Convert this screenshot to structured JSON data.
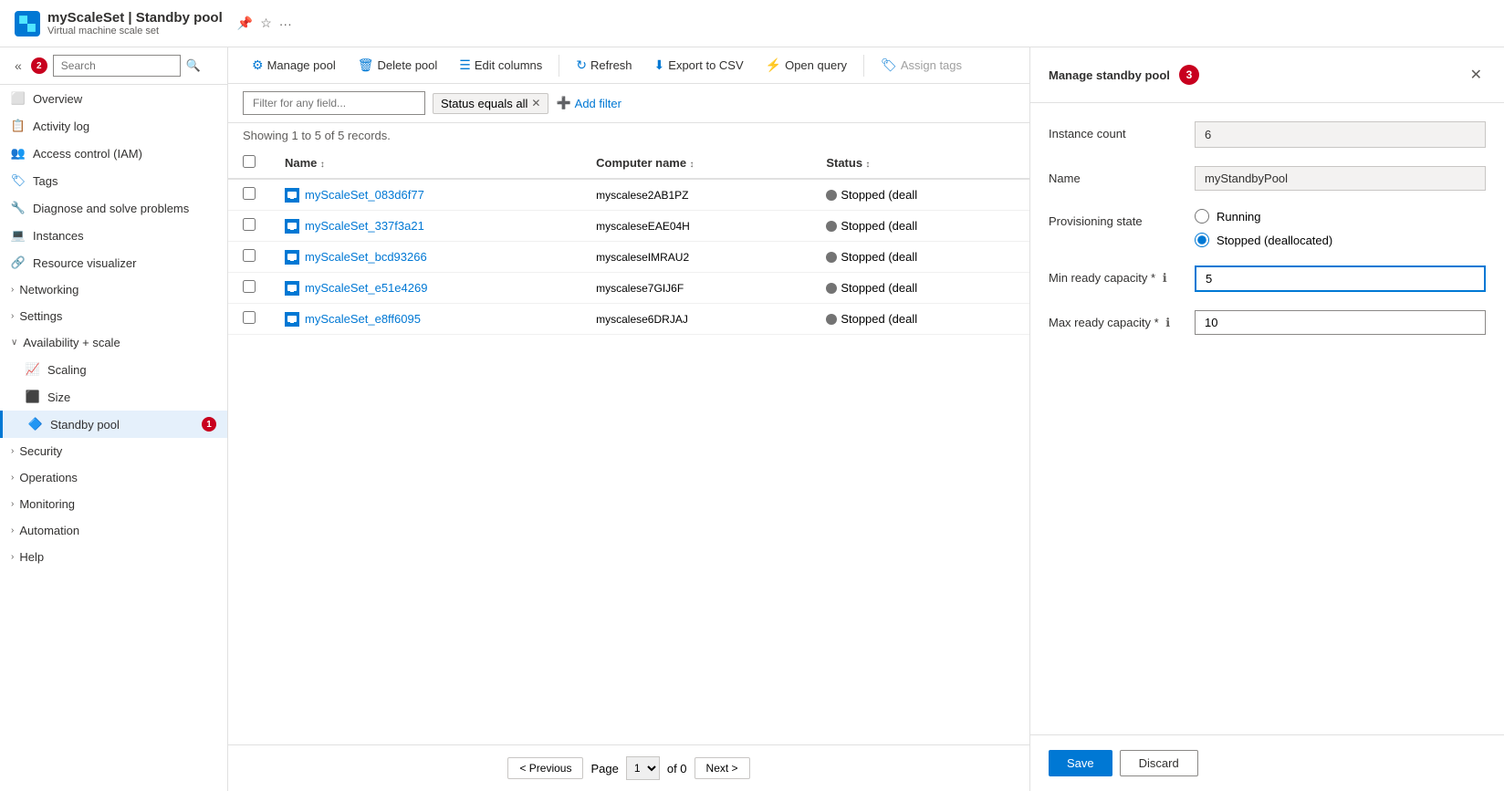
{
  "app": {
    "icon_label": "Azure",
    "title": "myScaleSet | Standby pool",
    "subtitle": "Virtual machine scale set",
    "pin_icon": "📌",
    "star_icon": "☆",
    "more_icon": "..."
  },
  "sidebar": {
    "search_placeholder": "Search",
    "collapse_icon": "«",
    "badge2": "2",
    "nav_items": [
      {
        "id": "overview",
        "label": "Overview",
        "icon": "overview"
      },
      {
        "id": "activity-log",
        "label": "Activity log",
        "icon": "log"
      },
      {
        "id": "access-control",
        "label": "Access control (IAM)",
        "icon": "iam"
      },
      {
        "id": "tags",
        "label": "Tags",
        "icon": "tags"
      },
      {
        "id": "diagnose",
        "label": "Diagnose and solve problems",
        "icon": "diagnose"
      },
      {
        "id": "instances",
        "label": "Instances",
        "icon": "instances"
      },
      {
        "id": "resource-visualizer",
        "label": "Resource visualizer",
        "icon": "visualizer"
      },
      {
        "id": "networking",
        "label": "Networking",
        "icon": "networking",
        "expandable": true
      },
      {
        "id": "settings",
        "label": "Settings",
        "icon": "settings",
        "expandable": true
      }
    ],
    "availability_scale_section": "Availability + scale",
    "availability_scale_items": [
      {
        "id": "scaling",
        "label": "Scaling",
        "icon": "scaling"
      },
      {
        "id": "size",
        "label": "Size",
        "icon": "size"
      },
      {
        "id": "standby-pool",
        "label": "Standby pool",
        "icon": "standby",
        "active": true,
        "badge": "1"
      }
    ],
    "sections": [
      {
        "id": "security",
        "label": "Security",
        "expandable": true
      },
      {
        "id": "operations",
        "label": "Operations",
        "expandable": true
      },
      {
        "id": "monitoring",
        "label": "Monitoring",
        "expandable": true
      },
      {
        "id": "automation",
        "label": "Automation",
        "expandable": true
      },
      {
        "id": "help",
        "label": "Help",
        "expandable": true
      }
    ]
  },
  "toolbar": {
    "manage_pool": "Manage pool",
    "delete_pool": "Delete pool",
    "edit_columns": "Edit columns",
    "refresh": "Refresh",
    "export_csv": "Export to CSV",
    "open_query": "Open query",
    "assign_tags": "Assign tags"
  },
  "filter": {
    "placeholder": "Filter for any field...",
    "tag_text": "Status equals all",
    "add_filter": "+ Add filter"
  },
  "table": {
    "records_text": "Showing 1 to 5 of 5 records.",
    "columns": [
      {
        "id": "name",
        "label": "Name",
        "sortable": true
      },
      {
        "id": "computer_name",
        "label": "Computer name",
        "sortable": true
      },
      {
        "id": "status",
        "label": "Status",
        "sortable": true
      }
    ],
    "rows": [
      {
        "name": "myScaleSet_083d6f77",
        "computer_name": "myscalese2AB1PZ",
        "status": "Stopped (deall"
      },
      {
        "name": "myScaleSet_337f3a21",
        "computer_name": "myscaleseEAE04H",
        "status": "Stopped (deall"
      },
      {
        "name": "myScaleSet_bcd93266",
        "computer_name": "myscaleseIMRAU2",
        "status": "Stopped (deall"
      },
      {
        "name": "myScaleSet_e51e4269",
        "computer_name": "myscalese7GIJ6F",
        "status": "Stopped (deall"
      },
      {
        "name": "myScaleSet_e8ff6095",
        "computer_name": "myscalese6DRJAJ",
        "status": "Stopped (deall"
      }
    ]
  },
  "pagination": {
    "previous": "< Previous",
    "next": "Next >",
    "page_label": "Page",
    "of_label": "of 0"
  },
  "panel": {
    "title": "Manage standby pool",
    "badge": "3",
    "close_icon": "✕",
    "instance_count_label": "Instance count",
    "instance_count_value": "6",
    "name_label": "Name",
    "name_value": "myStandbyPool",
    "provisioning_state_label": "Provisioning state",
    "provisioning_options": [
      {
        "id": "running",
        "label": "Running",
        "checked": false
      },
      {
        "id": "stopped",
        "label": "Stopped (deallocated)",
        "checked": true
      }
    ],
    "min_ready_label": "Min ready capacity *",
    "min_ready_value": "5",
    "max_ready_label": "Max ready capacity *",
    "max_ready_value": "10",
    "save_label": "Save",
    "discard_label": "Discard"
  }
}
